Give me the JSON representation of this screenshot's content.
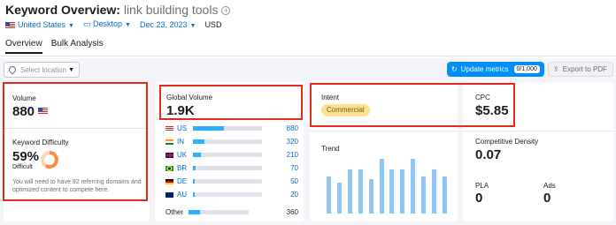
{
  "header": {
    "title": "Keyword Overview:",
    "keyword": "link building tools",
    "add_icon": "plus-circle-icon",
    "country": "United States",
    "device": "Desktop",
    "date": "Dec 23, 2023",
    "currency": "USD",
    "tabs": [
      "Overview",
      "Bulk Analysis"
    ]
  },
  "toolbar": {
    "location_placeholder": "Select location",
    "update_label": "Update metrics",
    "update_count": "0/1,000",
    "export_label": "Export to PDF"
  },
  "volume": {
    "label": "Volume",
    "value": "880"
  },
  "kd": {
    "label": "Keyword Difficulty",
    "value": "59%",
    "level": "Difficult",
    "percent": 59,
    "note": "You will need to have 92 referring domains and optimized content to compete here."
  },
  "global_volume": {
    "label": "Global Volume",
    "value": "1.9K",
    "countries": [
      {
        "code": "US",
        "value": "880",
        "share": 0.45
      },
      {
        "code": "IN",
        "value": "320",
        "share": 0.17
      },
      {
        "code": "UK",
        "value": "210",
        "share": 0.11
      },
      {
        "code": "BR",
        "value": "70",
        "share": 0.04
      },
      {
        "code": "DE",
        "value": "50",
        "share": 0.03
      },
      {
        "code": "AU",
        "value": "20",
        "share": 0.02
      }
    ],
    "other": {
      "label": "Other",
      "value": "360",
      "share": 0.19
    }
  },
  "intent": {
    "label": "Intent",
    "value": "Commercial"
  },
  "trend": {
    "label": "Trend",
    "values": [
      0.6,
      0.5,
      0.72,
      0.72,
      0.55,
      0.88,
      0.72,
      0.72,
      0.88,
      0.6,
      0.72,
      0.6
    ]
  },
  "cpc": {
    "label": "CPC",
    "value": "$5.85"
  },
  "competitive_density": {
    "label": "Competitive Density",
    "value": "0.07"
  },
  "pla": {
    "label": "PLA",
    "value": "0"
  },
  "ads": {
    "label": "Ads",
    "value": "0"
  },
  "colors": {
    "accent": "#008ff8",
    "link": "#006dca",
    "highlight": "#e8271f",
    "bar": "#2bafff"
  }
}
